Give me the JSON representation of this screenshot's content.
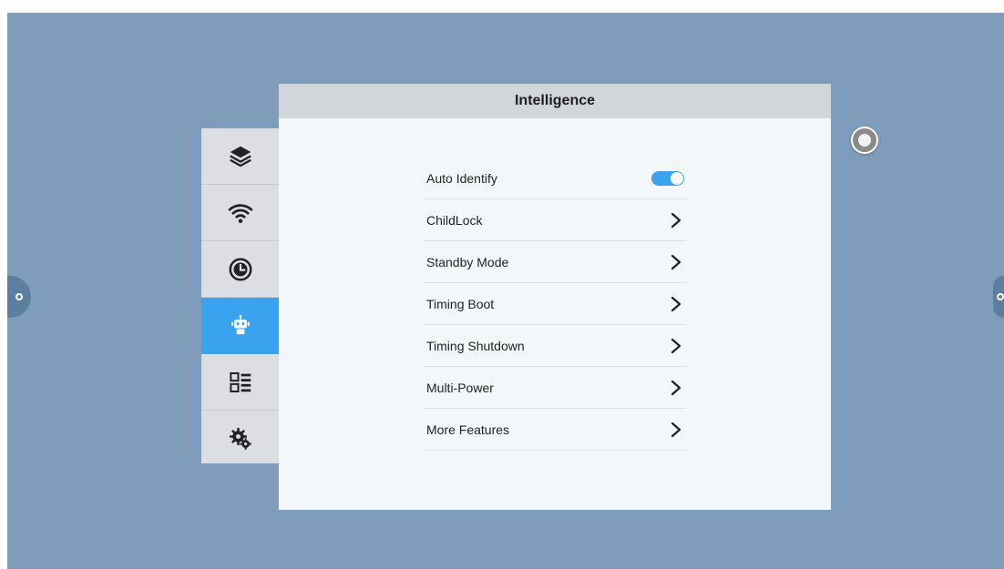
{
  "panel": {
    "title": "Intelligence"
  },
  "sidebar": {
    "items": [
      {
        "icon": "layers-icon",
        "active": false
      },
      {
        "icon": "wifi-icon",
        "active": false
      },
      {
        "icon": "clock-icon",
        "active": false
      },
      {
        "icon": "robot-icon",
        "active": true
      },
      {
        "icon": "list-icon",
        "active": false
      },
      {
        "icon": "gears-icon",
        "active": false
      }
    ]
  },
  "settings": {
    "rows": [
      {
        "label": "Auto Identify",
        "control": "toggle",
        "value": "on"
      },
      {
        "label": "ChildLock",
        "control": "chevron"
      },
      {
        "label": "Standby Mode",
        "control": "chevron"
      },
      {
        "label": "Timing Boot",
        "control": "chevron"
      },
      {
        "label": "Timing Shutdown",
        "control": "chevron"
      },
      {
        "label": "Multi-Power",
        "control": "chevron"
      },
      {
        "label": "More Features",
        "control": "chevron"
      }
    ]
  },
  "colors": {
    "accent": "#3aa3ef",
    "desktop": "#7f9dbb",
    "panel_bg": "#f3f7fa",
    "header_bg": "#d2d5d9",
    "sidebar_bg": "#dcdee3"
  }
}
